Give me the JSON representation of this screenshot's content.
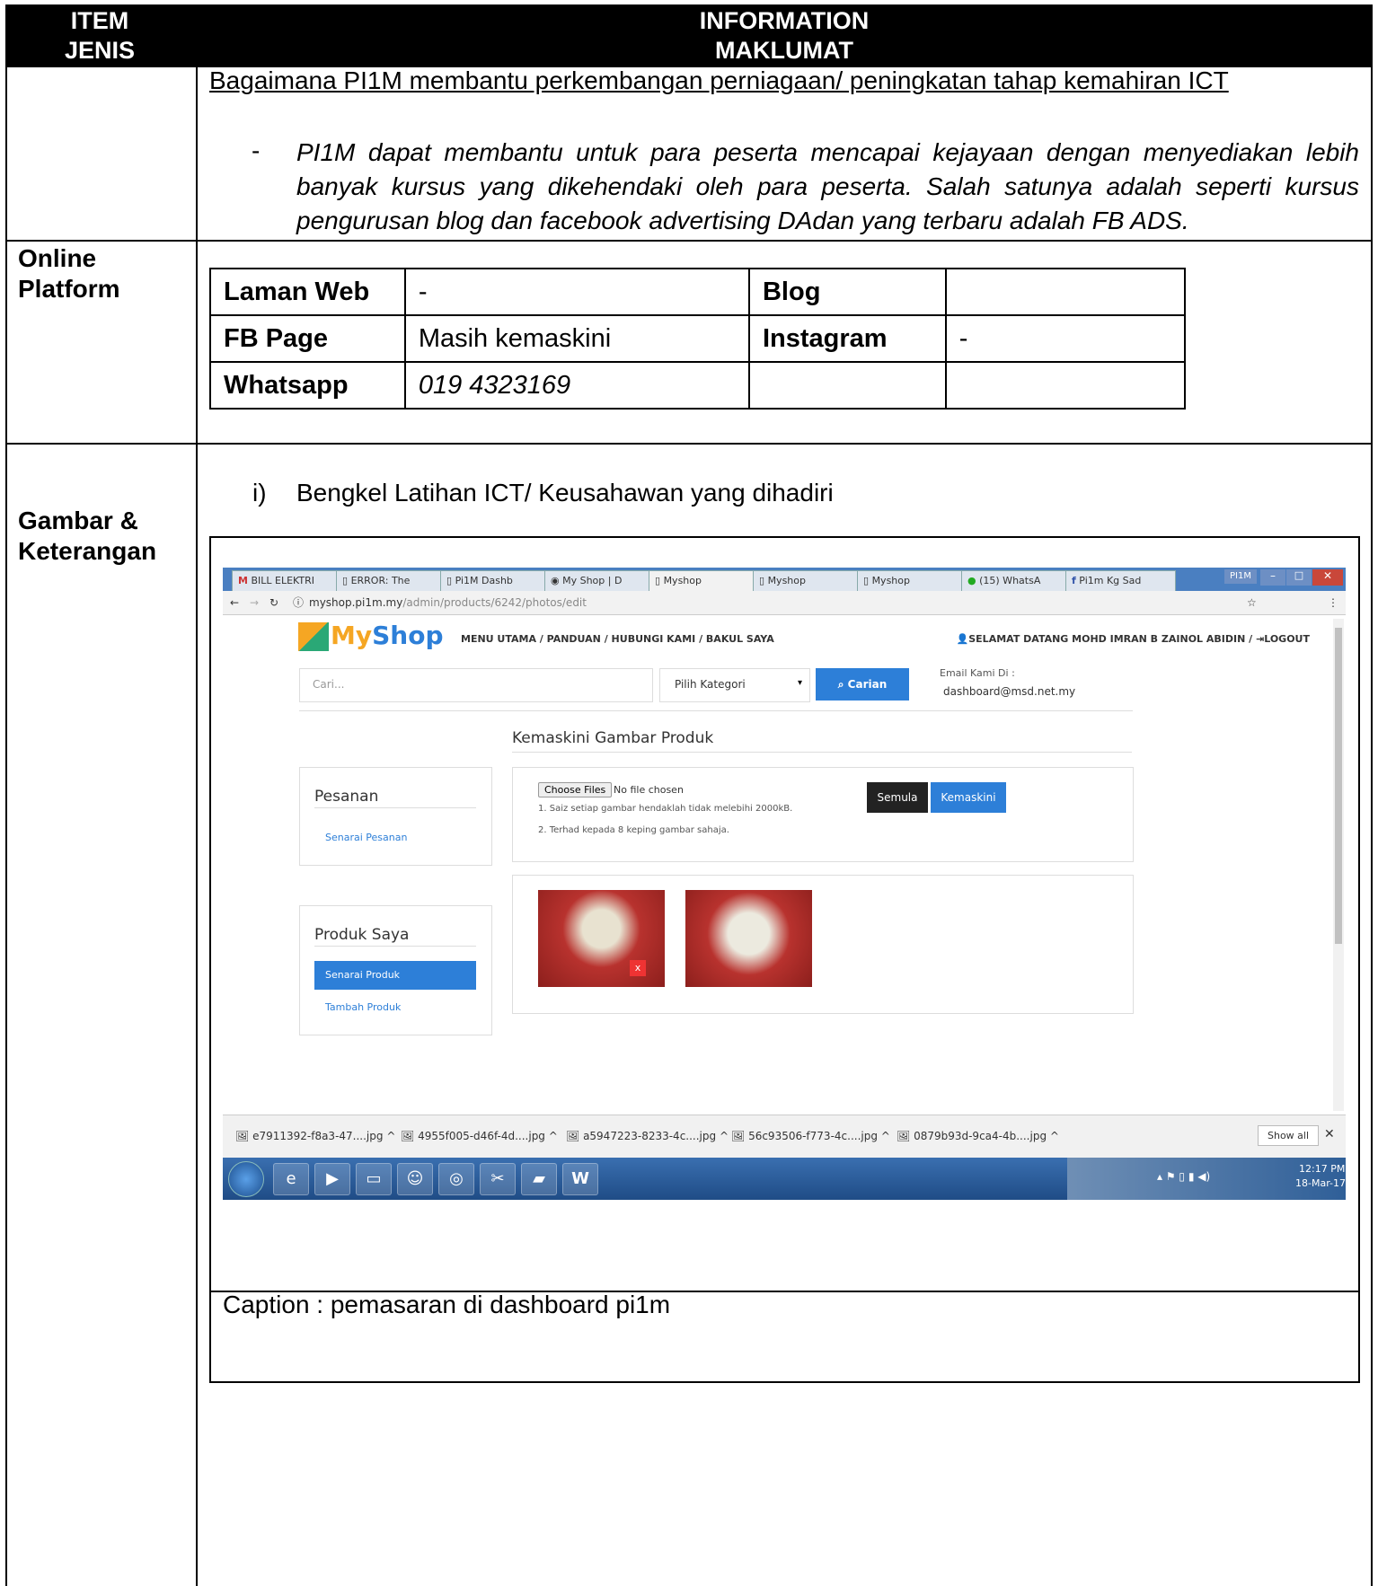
{
  "header": {
    "col1_line1": "ITEM",
    "col1_line2": "JENIS",
    "col2_line1": "INFORMATION",
    "col2_line2": "MAKLUMAT"
  },
  "row1": {
    "question": "Bagaimana PI1M membantu perkembangan perniagaan/ peningkatan tahap kemahiran ICT",
    "bullet_mark": "-",
    "bullet_text": "PI1M dapat membantu untuk para peserta mencapai kejayaan dengan menyediakan lebih banyak kursus yang dikehendaki oleh para peserta. Salah satunya adalah seperti kursus pengurusan blog dan facebook advertising DAdan yang terbaru adalah FB ADS."
  },
  "row2": {
    "label_line1": "Online",
    "label_line2": "Platform",
    "table": [
      [
        "Laman Web",
        "-",
        "Blog",
        ""
      ],
      [
        "FB Page",
        "Masih kemaskini",
        "Instagram",
        "-"
      ],
      [
        "Whatsapp",
        "019 4323169",
        "",
        ""
      ]
    ]
  },
  "row3": {
    "label_line1": "Gambar &",
    "label_line2": "Keterangan",
    "item_num": "i)",
    "item_text": "Bengkel Latihan ICT/ Keusahawan yang dihadiri",
    "caption": "Caption : pemasaran di  dashboard pi1m"
  },
  "screenshot": {
    "tabs": [
      "BILL ELEKTRI",
      "ERROR: The",
      "Pi1M Dashb",
      "My Shop | D",
      "Myshop",
      "Myshop",
      "Myshop",
      "(15) WhatsA",
      "Pi1m Kg Sad"
    ],
    "window_badge": "PI1M",
    "url_host": "myshop.pi1m.my",
    "url_path": "/admin/products/6242/photos/edit",
    "logo_my": "My",
    "logo_shop": "Shop",
    "nav": "MENU UTAMA  /  PANDUAN  /  HUBUNGI KAMI  /  BAKUL SAYA",
    "welcome": "SELAMAT DATANG MOHD IMRAN B ZAINOL ABIDIN  /  ",
    "logout": "LOGOUT",
    "search_placeholder": "Cari...",
    "category": "Pilih Kategori",
    "search_btn": "Carian",
    "email_label": "Email Kami Di :",
    "email": "dashboard@msd.net.my",
    "page_title": "Kemaskini Gambar Produk",
    "side1_title": "Pesanan",
    "side1_link": "Senarai Pesanan",
    "side2_title": "Produk Saya",
    "side2_active": "Senarai Produk",
    "side2_link": "Tambah Produk",
    "choose_files": "Choose Files",
    "no_file": "No file chosen",
    "note1": "1. Saiz setiap gambar hendaklah tidak melebihi 2000kB.",
    "note2": "2. Terhad kepada 8 keping gambar sahaja.",
    "btn_reset": "Semula",
    "btn_update": "Kemaskini",
    "delete_mark": "x",
    "downloads": [
      "e7911392-f8a3-47....jpg",
      "4955f005-d46f-4d....jpg",
      "a5947223-8233-4c....jpg",
      "56c93506-f773-4c....jpg",
      "0879b93d-9ca4-4b....jpg"
    ],
    "show_all": "Show all",
    "time": "12:17 PM",
    "date": "18-Mar-17"
  }
}
